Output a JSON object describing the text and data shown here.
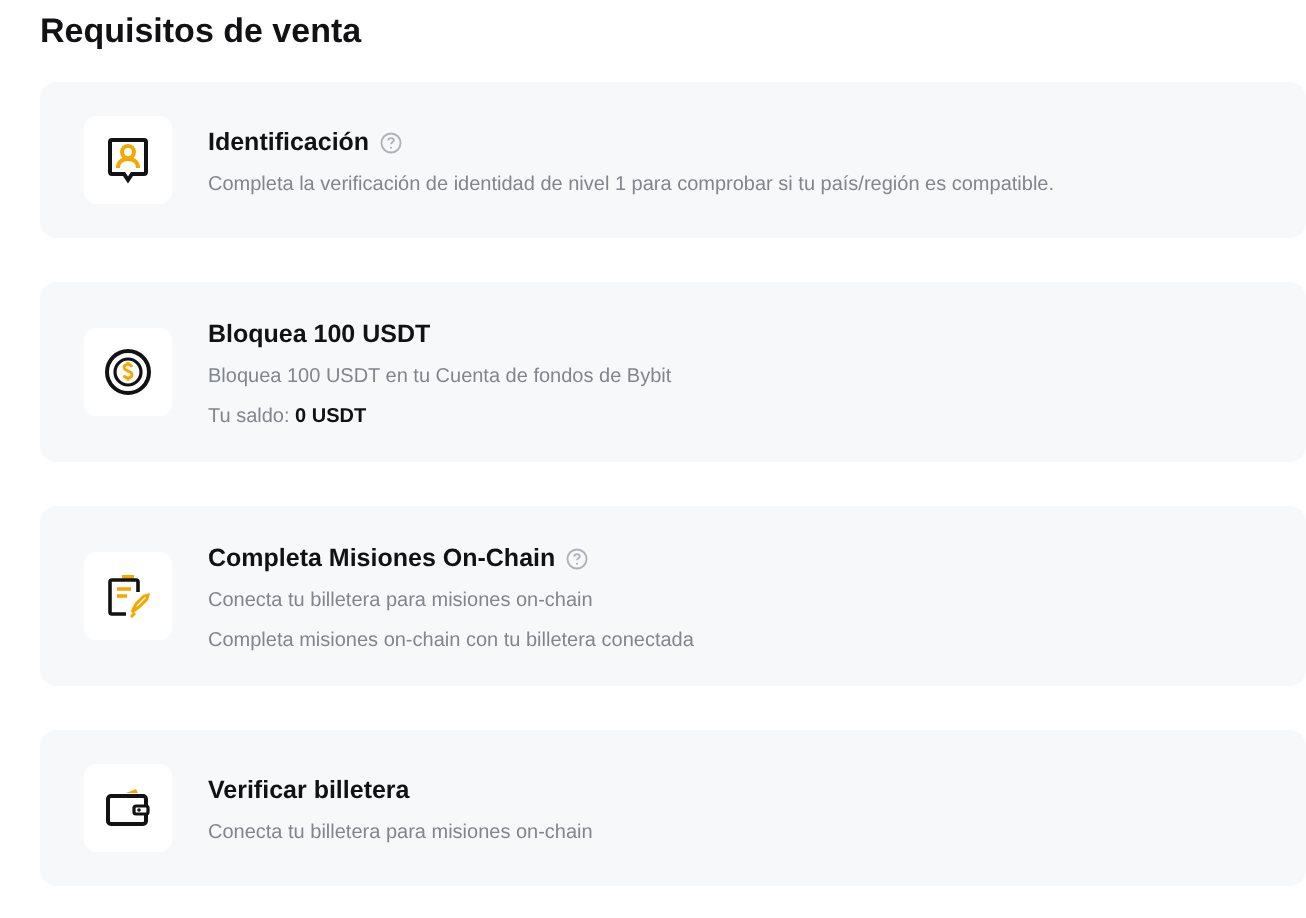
{
  "title": "Requisitos de venta",
  "requirements": [
    {
      "kind": "identity",
      "title": "Identificación",
      "help": true,
      "lines": [
        "Completa la verificación de identidad de nivel 1 para comprobar si tu país/región es compatible."
      ]
    },
    {
      "kind": "coin",
      "title": "Bloquea 100 USDT",
      "help": false,
      "lines": [
        "Bloquea 100 USDT en tu Cuenta de fondos de Bybit",
        "Tu saldo: **0 USDT**"
      ]
    },
    {
      "kind": "tasks",
      "title": "Completa Misiones On-Chain",
      "help": true,
      "lines": [
        "Conecta tu billetera para misiones on-chain",
        "Completa misiones on-chain con tu billetera conectada"
      ]
    },
    {
      "kind": "wallet",
      "title": "Verificar billetera",
      "help": false,
      "lines": [
        "Conecta tu billetera para misiones on-chain"
      ]
    }
  ]
}
